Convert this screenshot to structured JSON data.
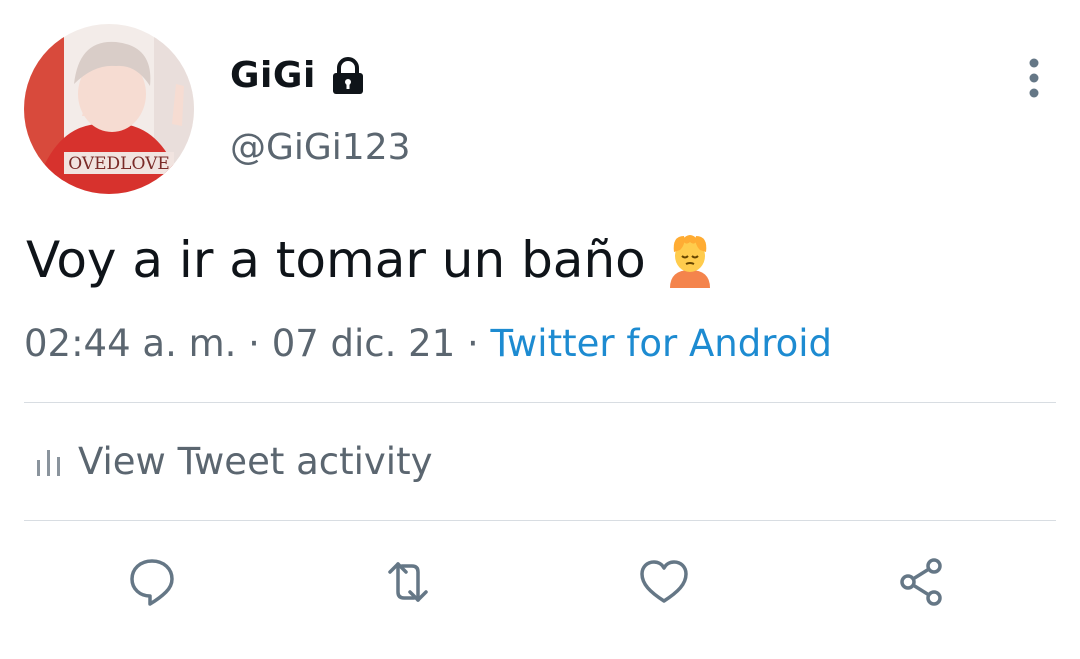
{
  "tweet": {
    "display_name": "GiGi",
    "handle": "@GiGi123",
    "text": "Voy a ir a tomar un baño",
    "time": "02:44 a. m.",
    "separator": "·",
    "date": "07 dic. 21",
    "source": "Twitter for Android",
    "avatar_text": "OVEDLOVE"
  },
  "activity": {
    "label": "View Tweet activity"
  },
  "icons": {
    "lock": "lock-icon",
    "more": "more-vertical-icon",
    "emoji": "person-in-bath-emoji-icon",
    "activity": "bar-chart-icon",
    "reply": "comment-icon",
    "retweet": "retweet-icon",
    "like": "heart-icon",
    "share": "share-icon"
  },
  "colors": {
    "text": "#0f1419",
    "secondary": "#5b6670",
    "link": "#1d8bd1",
    "divider": "#d8dde2",
    "icon": "#657786"
  }
}
